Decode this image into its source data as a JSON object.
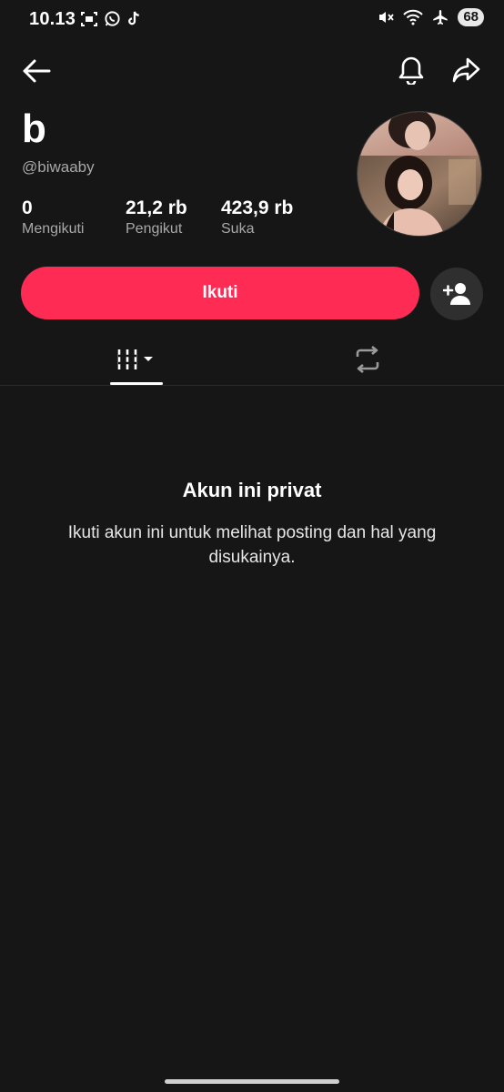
{
  "status_bar": {
    "time": "10.13",
    "battery": "68",
    "left_icons": [
      "screen-record-icon",
      "whatsapp-icon",
      "tiktok-icon"
    ],
    "right_icons": [
      "mute-icon",
      "wifi-icon",
      "airplane-icon"
    ]
  },
  "header": {
    "back_icon": "arrow-left-icon",
    "notification_icon": "bell-icon",
    "share_icon": "share-icon"
  },
  "profile": {
    "name": "b",
    "handle": "@biwaaby",
    "stats": [
      {
        "value": "0",
        "label": "Mengikuti"
      },
      {
        "value": "21,2 rb",
        "label": "Pengikut"
      },
      {
        "value": "423,9 rb",
        "label": "Suka"
      }
    ]
  },
  "actions": {
    "follow_label": "Ikuti",
    "add_friend_icon": "add-friend-icon"
  },
  "tabs": [
    {
      "icon": "grid-icon",
      "active": true
    },
    {
      "icon": "repost-icon",
      "active": false
    }
  ],
  "private": {
    "title": "Akun ini privat",
    "description": "Ikuti akun ini untuk melihat posting dan hal yang disukainya."
  },
  "colors": {
    "background": "#161616",
    "accent": "#fe2c55",
    "secondary_text": "#a8a8a8"
  }
}
